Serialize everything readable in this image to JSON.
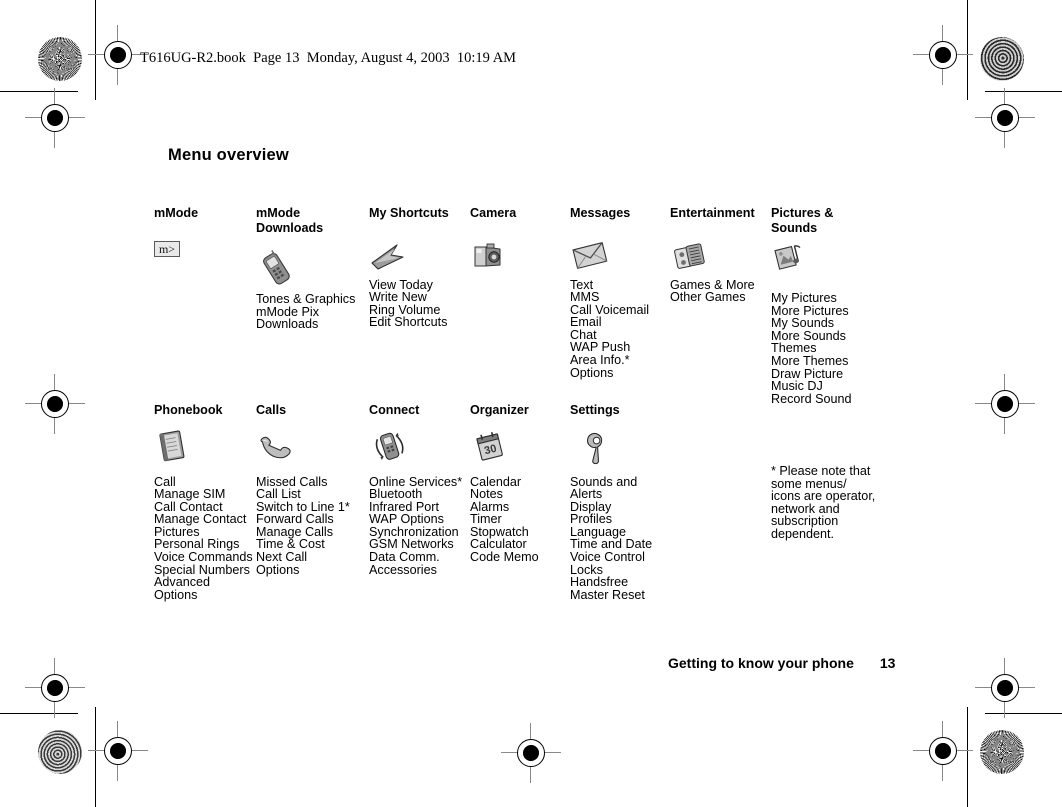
{
  "document": {
    "file_header": "T616UG-R2.book  Page 13  Monday, August 4, 2003  10:19 AM",
    "page_title": "Menu overview",
    "footer_title": "Getting to know your phone",
    "footer_page": "13"
  },
  "footnote": "* Please note that\nsome menus/\nicons are operator,\nnetwork and\nsubscription\ndependent.",
  "menu_rows": [
    {
      "columns": [
        {
          "header": "mMode",
          "icon": "mmode-badge-icon",
          "items": []
        },
        {
          "header": "mMode\nDownloads",
          "icon": "phone-icon",
          "items": [
            "Tones & Graphics",
            "mMode Pix",
            "Downloads"
          ]
        },
        {
          "header": "My Shortcuts",
          "icon": "arrow-cursor-icon",
          "items": [
            "View Today",
            "Write New",
            "Ring Volume",
            "Edit Shortcuts"
          ]
        },
        {
          "header": "Camera",
          "icon": "camera-icon",
          "items": []
        },
        {
          "header": "Messages",
          "icon": "envelope-icon",
          "items": [
            "Text",
            "MMS",
            "Call Voicemail",
            "Email",
            "Chat",
            "WAP Push",
            "Area Info.*",
            "Options"
          ]
        },
        {
          "header": "Entertainment",
          "icon": "games-icon",
          "items": [
            "Games & More",
            "Other Games"
          ]
        },
        {
          "header": "Pictures &\nSounds",
          "icon": "pictures-sounds-icon",
          "items": [
            "My Pictures",
            "More Pictures",
            "My Sounds",
            "More Sounds",
            "Themes",
            "More Themes",
            "Draw Picture",
            "Music DJ",
            "Record Sound"
          ]
        }
      ]
    },
    {
      "columns": [
        {
          "header": "Phonebook",
          "icon": "book-icon",
          "items": [
            "Call",
            "Manage SIM",
            "Call Contact",
            "Manage Contact",
            "Pictures",
            "Personal Rings",
            "Voice Commands",
            "Special Numbers",
            "Advanced",
            "Options"
          ]
        },
        {
          "header": "Calls",
          "icon": "handset-icon",
          "items": [
            "Missed Calls",
            "Call List",
            "Switch to Line 1*",
            "Forward Calls",
            "Manage Calls",
            "Time & Cost",
            "Next Call",
            "Options"
          ]
        },
        {
          "header": "Connect",
          "icon": "connect-icon",
          "items": [
            "Online Services*",
            "Bluetooth",
            "Infrared Port",
            "WAP Options",
            "Synchronization",
            "GSM Networks",
            "Data Comm.",
            "Accessories"
          ]
        },
        {
          "header": "Organizer",
          "icon": "calendar-icon",
          "items": [
            "Calendar",
            "Notes",
            "Alarms",
            "Timer",
            "Stopwatch",
            "Calculator",
            "Code Memo"
          ]
        },
        {
          "header": "Settings",
          "icon": "wrench-icon",
          "items": [
            "Sounds and",
            "Alerts",
            "Display",
            "Profiles",
            "Language",
            "Time and Date",
            "Voice Control",
            "Locks",
            "Handsfree",
            "Master Reset"
          ]
        }
      ]
    }
  ],
  "icons": {
    "mmode_label": "m>"
  },
  "colors": {
    "text": "#000000",
    "paper": "#ffffff",
    "mark": "#888888"
  }
}
